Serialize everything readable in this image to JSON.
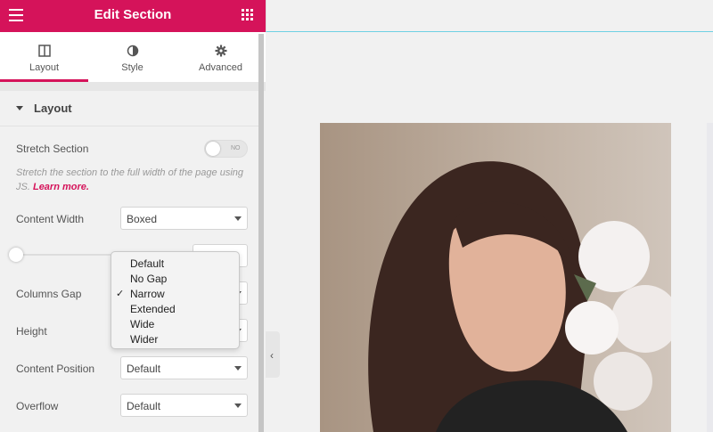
{
  "header": {
    "title": "Edit Section"
  },
  "tabs": [
    {
      "label": "Layout",
      "icon": "columns-icon",
      "active": true
    },
    {
      "label": "Style",
      "icon": "half-circle-icon",
      "active": false
    },
    {
      "label": "Advanced",
      "icon": "gear-icon",
      "active": false
    }
  ],
  "section": {
    "title": "Layout"
  },
  "fields": {
    "stretch_label": "Stretch Section",
    "stretch_toggle_text": "NO",
    "help_text": "Stretch the section to the full width of the page using JS.",
    "help_link": "Learn more.",
    "content_width_label": "Content Width",
    "content_width_value": "Boxed",
    "columns_gap_label": "Columns Gap",
    "height_label": "Height",
    "content_position_label": "Content Position",
    "content_position_value": "Default",
    "overflow_label": "Overflow",
    "overflow_value": "Default"
  },
  "dropdown": {
    "options": [
      "Default",
      "No Gap",
      "Narrow",
      "Extended",
      "Wide",
      "Wider"
    ],
    "selected": "Narrow",
    "check": "✓"
  },
  "colors": {
    "brand": "#d5135a",
    "frame_outline": "#6fd0e3"
  }
}
